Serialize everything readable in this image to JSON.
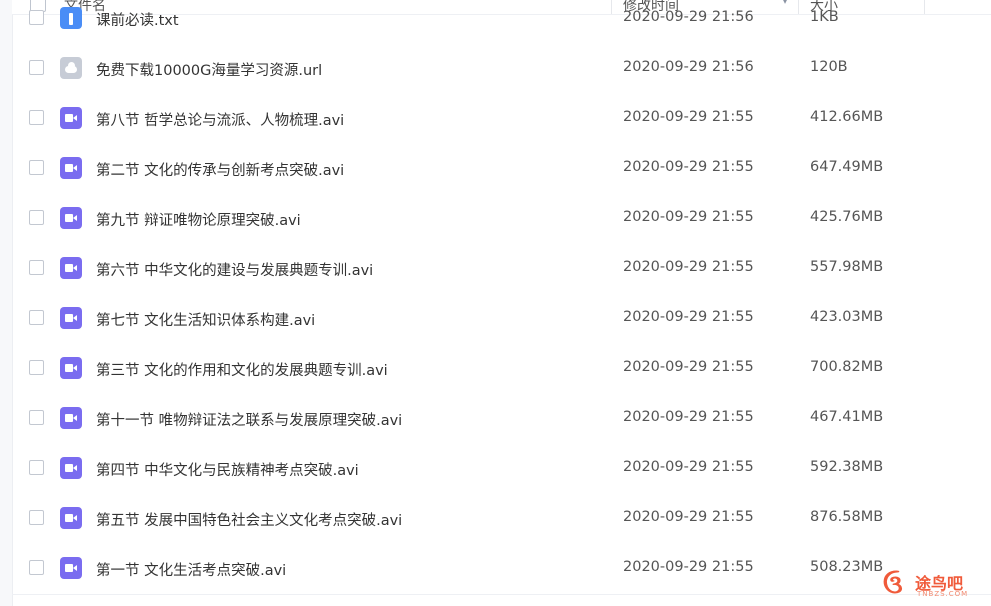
{
  "header": {
    "name_label": "文件名",
    "time_label": "修改时间",
    "size_label": "大小"
  },
  "files": [
    {
      "name": "课前必读.txt",
      "time": "2020-09-29 21:56",
      "size": "1KB",
      "icon": "text-file-icon"
    },
    {
      "name": "免费下载10000G海量学习资源.url",
      "time": "2020-09-29 21:56",
      "size": "120B",
      "icon": "link-file-icon"
    },
    {
      "name": "第八节 哲学总论与流派、人物梳理.avi",
      "time": "2020-09-29 21:55",
      "size": "412.66MB",
      "icon": "video-file-icon"
    },
    {
      "name": "第二节 文化的传承与创新考点突破.avi",
      "time": "2020-09-29 21:55",
      "size": "647.49MB",
      "icon": "video-file-icon"
    },
    {
      "name": "第九节 辩证唯物论原理突破.avi",
      "time": "2020-09-29 21:55",
      "size": "425.76MB",
      "icon": "video-file-icon"
    },
    {
      "name": "第六节 中华文化的建设与发展典题专训.avi",
      "time": "2020-09-29 21:55",
      "size": "557.98MB",
      "icon": "video-file-icon"
    },
    {
      "name": "第七节 文化生活知识体系构建.avi",
      "time": "2020-09-29 21:55",
      "size": "423.03MB",
      "icon": "video-file-icon"
    },
    {
      "name": "第三节 文化的作用和文化的发展典题专训.avi",
      "time": "2020-09-29 21:55",
      "size": "700.82MB",
      "icon": "video-file-icon"
    },
    {
      "name": "第十一节 唯物辩证法之联系与发展原理突破.avi",
      "time": "2020-09-29 21:55",
      "size": "467.41MB",
      "icon": "video-file-icon"
    },
    {
      "name": "第四节 中华文化与民族精神考点突破.avi",
      "time": "2020-09-29 21:55",
      "size": "592.38MB",
      "icon": "video-file-icon"
    },
    {
      "name": "第五节 发展中国特色社会主义文化考点突破.avi",
      "time": "2020-09-29 21:55",
      "size": "876.58MB",
      "icon": "video-file-icon"
    },
    {
      "name": "第一节 文化生活考点突破.avi",
      "time": "2020-09-29 21:55",
      "size": "508.23MB",
      "icon": "video-file-icon"
    }
  ],
  "watermark": {
    "text": "途鸟吧",
    "sub": "TNBZS.COM"
  }
}
